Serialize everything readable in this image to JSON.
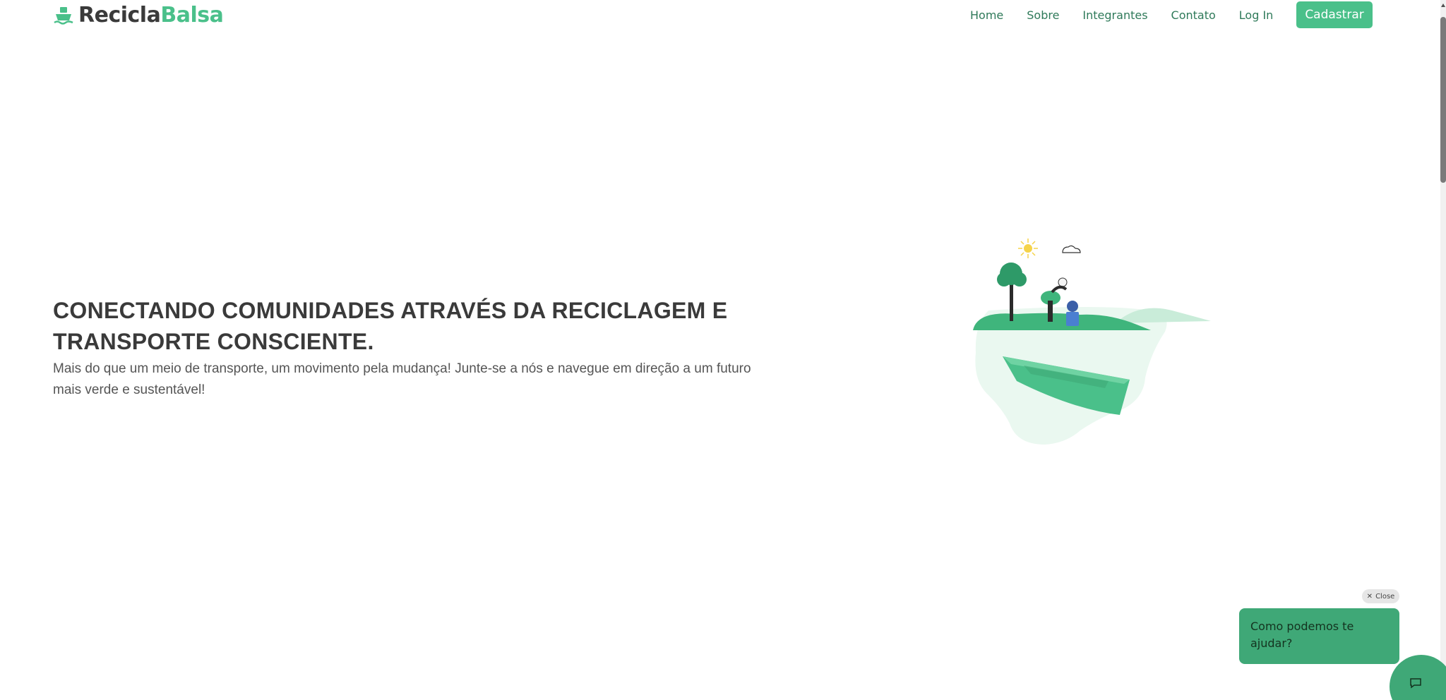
{
  "brand": {
    "part1": "Recicla",
    "part2": "Balsa",
    "icon": "ship-icon",
    "colors": {
      "dark": "#3a3a3a",
      "green": "#4ac08a"
    }
  },
  "nav": {
    "items": [
      "Home",
      "Sobre",
      "Integrantes",
      "Contato",
      "Log In"
    ],
    "cta": "Cadastrar"
  },
  "hero": {
    "title": "CONECTANDO COMUNIDADES ATRAVÉS DA RECICLAGEM E TRANSPORTE CONSCIENTE.",
    "subtitle": "Mais do que um meio de transporte, um movimento pela mudança! Junte-se a nós e navegue em direção a um futuro mais verde e sustentável!",
    "illustration": "recycling-boat-illustration"
  },
  "chat": {
    "close_label": "Close",
    "message": "Como podemos te ajudar?",
    "launcher_icon": "chat-icon",
    "accent": "#3fa877"
  }
}
